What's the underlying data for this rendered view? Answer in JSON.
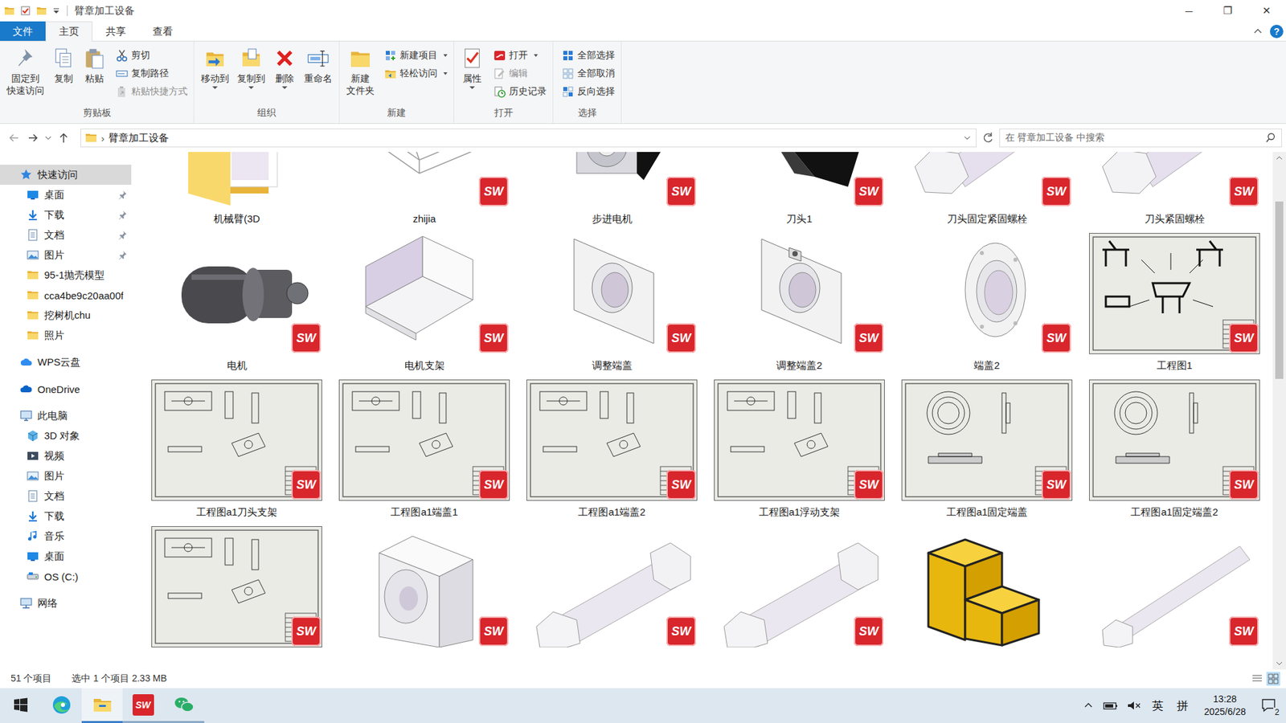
{
  "window": {
    "title": "臂章加工设备",
    "controls": [
      "─",
      "❐",
      "✕"
    ]
  },
  "ribbon_tabs": [
    {
      "label": "文件",
      "kind": "file",
      "selected": false
    },
    {
      "label": "主页",
      "kind": "tab",
      "selected": true
    },
    {
      "label": "共享",
      "kind": "tab",
      "selected": false
    },
    {
      "label": "查看",
      "kind": "tab",
      "selected": false
    }
  ],
  "ribbon_help": "?",
  "ribbon_groups": [
    {
      "label": "剪贴板",
      "large": [
        {
          "lines": [
            "固定到",
            "快速访问"
          ],
          "icon": "pin",
          "dropdown": false
        },
        {
          "lines": [
            "复制"
          ],
          "icon": "copy",
          "dropdown": false
        },
        {
          "lines": [
            "粘贴"
          ],
          "icon": "paste",
          "dropdown": false
        }
      ],
      "small": [
        {
          "label": "剪切",
          "icon": "cut",
          "dropdown": false,
          "disabled": false
        },
        {
          "label": "复制路径",
          "icon": "copypath",
          "dropdown": false,
          "disabled": false
        },
        {
          "label": "粘贴快捷方式",
          "icon": "pasteshortcut",
          "dropdown": false,
          "disabled": true
        }
      ]
    },
    {
      "label": "组织",
      "large": [
        {
          "lines": [
            "移动到"
          ],
          "icon": "moveto",
          "dropdown": true
        },
        {
          "lines": [
            "复制到"
          ],
          "icon": "copyto",
          "dropdown": true
        },
        {
          "lines": [
            "删除"
          ],
          "icon": "delete",
          "dropdown": true
        },
        {
          "lines": [
            "重命名"
          ],
          "icon": "rename",
          "dropdown": false
        }
      ],
      "small": []
    },
    {
      "label": "新建",
      "large": [
        {
          "lines": [
            "新建",
            "文件夹"
          ],
          "icon": "newfolder",
          "dropdown": false
        }
      ],
      "small": [
        {
          "label": "新建项目",
          "icon": "newitem",
          "dropdown": true,
          "disabled": false
        },
        {
          "label": "轻松访问",
          "icon": "easyaccess",
          "dropdown": true,
          "disabled": false
        }
      ]
    },
    {
      "label": "打开",
      "large": [
        {
          "lines": [
            "属性"
          ],
          "icon": "properties",
          "dropdown": true
        }
      ],
      "small": [
        {
          "label": "打开",
          "icon": "sw",
          "dropdown": true,
          "disabled": false
        },
        {
          "label": "编辑",
          "icon": "edit",
          "dropdown": false,
          "disabled": true
        },
        {
          "label": "历史记录",
          "icon": "history",
          "dropdown": false,
          "disabled": false
        }
      ]
    },
    {
      "label": "选择",
      "large": [],
      "small": [
        {
          "label": "全部选择",
          "icon": "selectall",
          "dropdown": false,
          "disabled": false
        },
        {
          "label": "全部取消",
          "icon": "selectnone",
          "dropdown": false,
          "disabled": false
        },
        {
          "label": "反向选择",
          "icon": "invert",
          "dropdown": false,
          "disabled": false
        }
      ]
    }
  ],
  "address": {
    "separator": "›",
    "path": "臂章加工设备",
    "search_placeholder": "在 臂章加工设备 中搜索"
  },
  "sidebar": {
    "items": [
      {
        "label": "快速访问",
        "icon": "star",
        "level": 0,
        "pinned": false,
        "selected": true,
        "group_start": false
      },
      {
        "label": "桌面",
        "icon": "desktop",
        "level": 1,
        "pinned": true,
        "selected": false,
        "group_start": false
      },
      {
        "label": "下载",
        "icon": "download",
        "level": 1,
        "pinned": true,
        "selected": false,
        "group_start": false
      },
      {
        "label": "文档",
        "icon": "document",
        "level": 1,
        "pinned": true,
        "selected": false,
        "group_start": false
      },
      {
        "label": "图片",
        "icon": "pictures",
        "level": 1,
        "pinned": true,
        "selected": false,
        "group_start": false
      },
      {
        "label": "95-1抛壳模型",
        "icon": "folder",
        "level": 1,
        "pinned": false,
        "selected": false,
        "group_start": false
      },
      {
        "label": "cca4be9c20aa00f",
        "icon": "folder",
        "level": 1,
        "pinned": false,
        "selected": false,
        "group_start": false
      },
      {
        "label": "挖树机chu",
        "icon": "folder",
        "level": 1,
        "pinned": false,
        "selected": false,
        "group_start": false
      },
      {
        "label": "照片",
        "icon": "folder",
        "level": 1,
        "pinned": false,
        "selected": false,
        "group_start": false
      },
      {
        "label": "WPS云盘",
        "icon": "wps",
        "level": 0,
        "pinned": false,
        "selected": false,
        "group_start": true
      },
      {
        "label": "OneDrive",
        "icon": "onedrive",
        "level": 0,
        "pinned": false,
        "selected": false,
        "group_start": true
      },
      {
        "label": "此电脑",
        "icon": "pc",
        "level": 0,
        "pinned": false,
        "selected": false,
        "group_start": true
      },
      {
        "label": "3D 对象",
        "icon": "cube",
        "level": 1,
        "pinned": false,
        "selected": false,
        "group_start": false
      },
      {
        "label": "视频",
        "icon": "video",
        "level": 1,
        "pinned": false,
        "selected": false,
        "group_start": false
      },
      {
        "label": "图片",
        "icon": "pictures",
        "level": 1,
        "pinned": false,
        "selected": false,
        "group_start": false
      },
      {
        "label": "文档",
        "icon": "document",
        "level": 1,
        "pinned": false,
        "selected": false,
        "group_start": false
      },
      {
        "label": "下载",
        "icon": "download",
        "level": 1,
        "pinned": false,
        "selected": false,
        "group_start": false
      },
      {
        "label": "音乐",
        "icon": "music",
        "level": 1,
        "pinned": false,
        "selected": false,
        "group_start": false
      },
      {
        "label": "桌面",
        "icon": "desktop",
        "level": 1,
        "pinned": false,
        "selected": false,
        "group_start": false
      },
      {
        "label": "OS (C:)",
        "icon": "disk",
        "level": 1,
        "pinned": false,
        "selected": false,
        "group_start": false
      },
      {
        "label": "网络",
        "icon": "network",
        "level": 0,
        "pinned": false,
        "selected": false,
        "group_start": true
      }
    ]
  },
  "files": [
    {
      "name": "机械臂(3D",
      "kind": "folder",
      "badge": ""
    },
    {
      "name": "zhijia",
      "kind": "frame",
      "badge": "SW"
    },
    {
      "name": "步进电机",
      "kind": "stepper",
      "badge": "SW"
    },
    {
      "name": "刀头1",
      "kind": "blade",
      "badge": "SW"
    },
    {
      "name": "刀头固定紧固螺栓",
      "kind": "bolt",
      "badge": "SW"
    },
    {
      "name": "刀头紧固螺栓",
      "kind": "bolt",
      "badge": "SW"
    },
    {
      "name": "电机",
      "kind": "motor",
      "badge": "SW"
    },
    {
      "name": "电机支架",
      "kind": "bracket",
      "badge": "SW"
    },
    {
      "name": "调整端盖",
      "kind": "plate",
      "badge": "SW"
    },
    {
      "name": "调整端盖2",
      "kind": "plate2",
      "badge": "SW"
    },
    {
      "name": "端盖2",
      "kind": "flange",
      "badge": "SW"
    },
    {
      "name": "工程图1",
      "kind": "drawing-assembly",
      "badge": "SW"
    },
    {
      "name": "工程图a1刀头支架",
      "kind": "drawing-parts",
      "badge": "SW"
    },
    {
      "name": "工程图a1端盖1",
      "kind": "drawing-parts",
      "badge": "SW"
    },
    {
      "name": "工程图a1端盖2",
      "kind": "drawing-parts",
      "badge": "SW"
    },
    {
      "name": "工程图a1浮动支架",
      "kind": "drawing-parts",
      "badge": "SW"
    },
    {
      "name": "工程图a1固定端盖",
      "kind": "drawing-round",
      "badge": "SW"
    },
    {
      "name": "工程图a1固定端盖2",
      "kind": "drawing-round",
      "badge": "SW"
    },
    {
      "kind": "drawing-parts",
      "badge": "SW"
    },
    {
      "kind": "block",
      "badge": "SW"
    },
    {
      "kind": "nutbolt",
      "badge": "SW"
    },
    {
      "kind": "nutbolt",
      "badge": "SW"
    },
    {
      "kind": "yellowpart",
      "badge": ""
    },
    {
      "kind": "shaft",
      "badge": "SW"
    }
  ],
  "scrollbar": {
    "offset": 0.076,
    "size": 0.36
  },
  "status_bar": {
    "count": "51 个项目",
    "selection": "选中 1 个项目 2.33 MB"
  },
  "taskbar": {
    "apps": [
      {
        "icon": "start",
        "badge": "",
        "running": false,
        "active": false
      },
      {
        "icon": "edge",
        "badge": "",
        "running": false,
        "active": false
      },
      {
        "icon": "explorer",
        "badge": "",
        "running": true,
        "active": true
      },
      {
        "icon": "solidworks",
        "badge": "SW",
        "running": true,
        "active": false
      },
      {
        "icon": "wechat",
        "badge": "",
        "running": true,
        "active": false
      }
    ],
    "tray": {
      "language": "英",
      "ime": "拼",
      "time": "13:28",
      "date": "2025/6/28",
      "notifications": "2",
      "muted": true
    }
  }
}
